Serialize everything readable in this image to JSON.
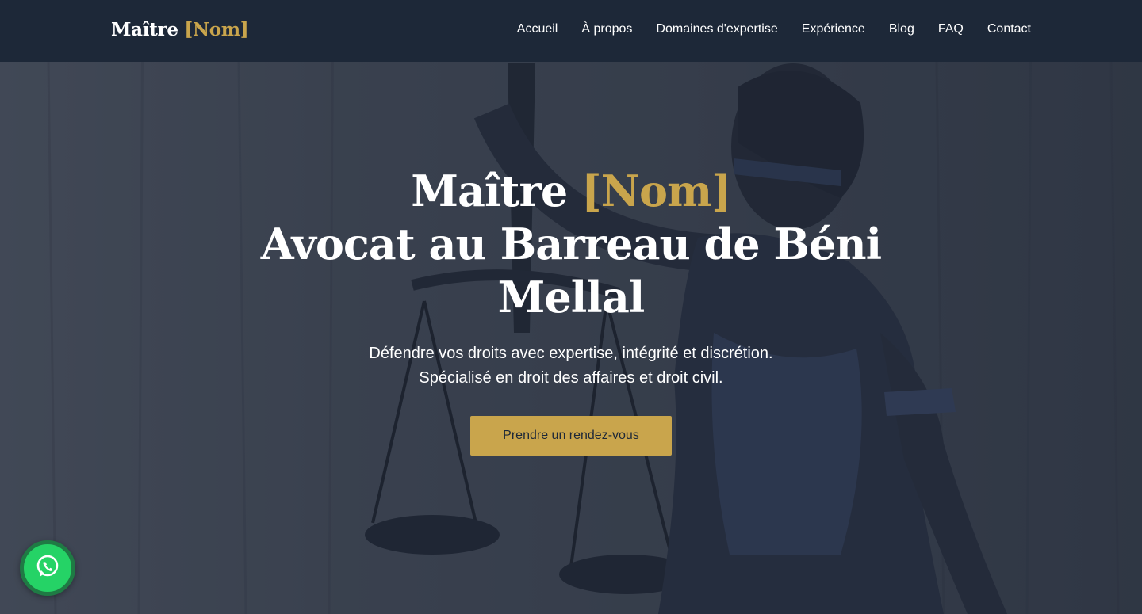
{
  "navbar": {
    "logo_text": "Maître ",
    "logo_accent": "[Nom]",
    "links": [
      "Accueil",
      "À propos",
      "Domaines d'expertise",
      "Expérience",
      "Blog",
      "FAQ",
      "Contact"
    ]
  },
  "hero": {
    "title_line1": "Maître ",
    "title_accent": "[Nom]",
    "title_line2": "Avocat au Barreau de Béni Mellal",
    "subtitle_line1": "Défendre vos droits avec expertise, intégrité et discrétion.",
    "subtitle_line2": "Spécialisé en droit des affaires et droit civil.",
    "cta_label": "Prendre un rendez-vous"
  },
  "floating": {
    "whatsapp_icon": "whatsapp-icon"
  },
  "colors": {
    "navbar_bg": "#1d2838",
    "accent_gold": "#c9a54c",
    "whatsapp_green": "#25d366"
  }
}
